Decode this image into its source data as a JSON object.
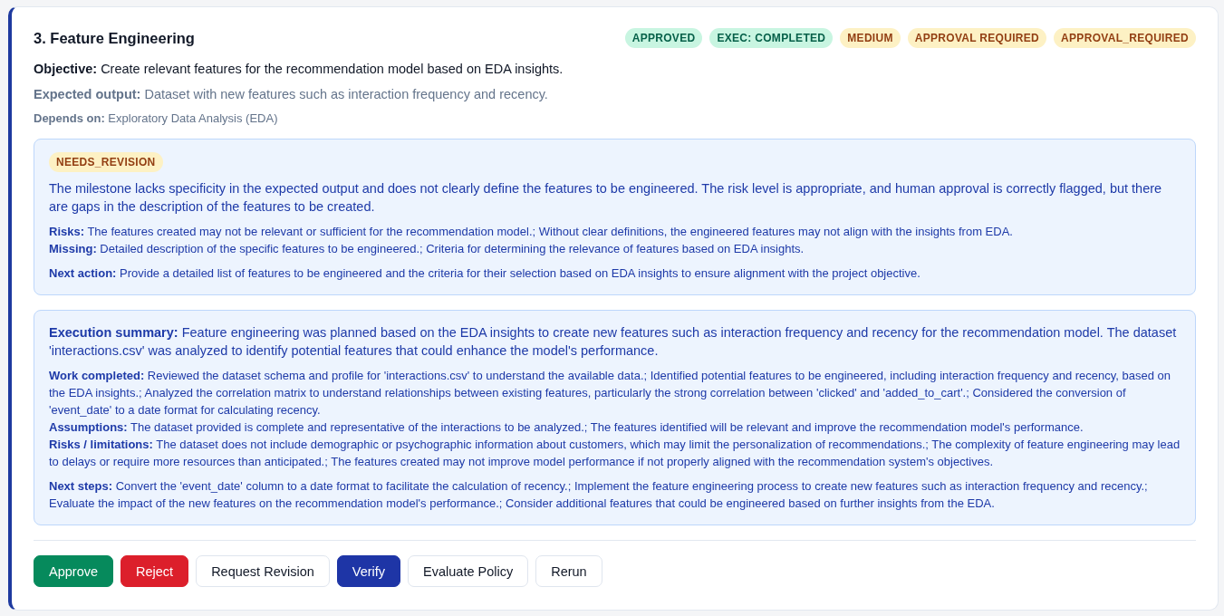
{
  "milestone": {
    "title": "3. Feature Engineering",
    "badges": [
      {
        "label": "APPROVED",
        "kind": "success"
      },
      {
        "label": "EXEC: COMPLETED",
        "kind": "success"
      },
      {
        "label": "MEDIUM",
        "kind": "warning"
      },
      {
        "label": "APPROVAL REQUIRED",
        "kind": "warning"
      },
      {
        "label": "APPROVAL_REQUIRED",
        "kind": "warning"
      }
    ],
    "fields": [
      {
        "kind": "objective",
        "text": "**Objective:** Create relevant features for the recommendation model based on EDA insights."
      },
      {
        "kind": "expected",
        "text": "**Expected output:** Dataset with new features such as interaction frequency and recency."
      },
      {
        "kind": "depends",
        "text": "**Depends on:** Exploratory Data Analysis (EDA)"
      }
    ]
  },
  "review": {
    "verdict": {
      "label": "NEEDS_REVISION",
      "kind": "warning"
    },
    "summary": "The milestone lacks specificity in the expected output and does not clearly define the features to be engineered. The risk level is appropriate, and human approval is correctly flagged, but there are gaps in the description of the features to be created.",
    "groups": [
      [
        "**Risks:** The features created may not be relevant or sufficient for the recommendation model.; Without clear definitions, the engineered features may not align with the insights from EDA.",
        "**Missing:** Detailed description of the specific features to be engineered.; Criteria for determining the relevance of features based on EDA insights."
      ],
      [
        "**Next action:** Provide a detailed list of features to be engineered and the criteria for their selection based on EDA insights to ensure alignment with the project objective."
      ]
    ]
  },
  "execution": {
    "summary": "**Execution summary:** Feature engineering was planned based on the EDA insights to create new features such as interaction frequency and recency for the recommendation model. The dataset 'interactions.csv' was analyzed to identify potential features that could enhance the model's performance.",
    "groups": [
      [
        "**Work completed:** Reviewed the dataset schema and profile for 'interactions.csv' to understand the available data.; Identified potential features to be engineered, including interaction frequency and recency, based on the EDA insights.; Analyzed the correlation matrix to understand relationships between existing features, particularly the strong correlation between 'clicked' and 'added_to_cart'.; Considered the conversion of 'event_date' to a date format for calculating recency.",
        "**Assumptions:** The dataset provided is complete and representative of the interactions to be analyzed.; The features identified will be relevant and improve the recommendation model's performance.",
        "**Risks / limitations:** The dataset does not include demographic or psychographic information about customers, which may limit the personalization of recommendations.; The complexity of feature engineering may lead to delays or require more resources than anticipated.; The features created may not improve model performance if not properly aligned with the recommendation system's objectives."
      ],
      [
        "**Next steps:** Convert the 'event_date' column to a date format to facilitate the calculation of recency.; Implement the feature engineering process to create new features such as interaction frequency and recency.; Evaluate the impact of the new features on the recommendation model's performance.; Consider additional features that could be engineered based on further insights from the EDA."
      ]
    ]
  },
  "actions": [
    {
      "label": "Approve",
      "kind": "success"
    },
    {
      "label": "Reject",
      "kind": "danger"
    },
    {
      "label": "Request Revision",
      "kind": "outline"
    },
    {
      "label": "Verify",
      "kind": "primary"
    },
    {
      "label": "Evaluate Policy",
      "kind": "outline"
    },
    {
      "label": "Rerun",
      "kind": "outline"
    }
  ]
}
